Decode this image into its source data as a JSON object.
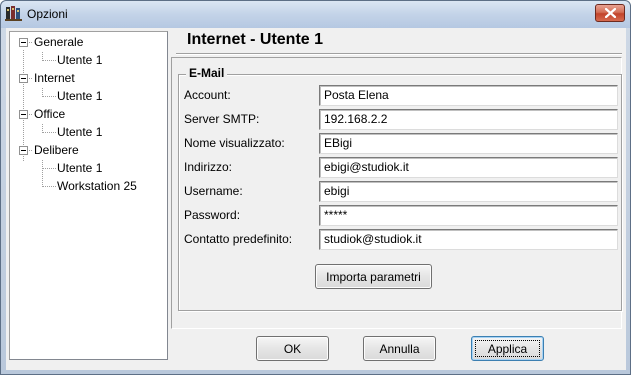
{
  "window": {
    "title": "Opzioni",
    "icon": "app-icon",
    "close_icon": "close-icon"
  },
  "tree": {
    "items": [
      {
        "label": "Generale",
        "level": 0
      },
      {
        "label": "Utente  1",
        "level": 1
      },
      {
        "label": "Internet",
        "level": 0
      },
      {
        "label": "Utente  1",
        "level": 1
      },
      {
        "label": "Office",
        "level": 0
      },
      {
        "label": "Utente  1",
        "level": 1
      },
      {
        "label": "Delibere",
        "level": 0
      },
      {
        "label": "Utente  1",
        "level": 1
      },
      {
        "label": "Workstation 25",
        "level": 1
      }
    ]
  },
  "panel": {
    "title": "Internet - Utente  1",
    "group_title": "E-Mail",
    "fields": [
      {
        "label": "Account:",
        "value": "Posta Elena"
      },
      {
        "label": "Server SMTP:",
        "value": "192.168.2.2"
      },
      {
        "label": "Nome visualizzato:",
        "value": "EBigi"
      },
      {
        "label": "Indirizzo:",
        "value": "ebigi@studiok.it"
      },
      {
        "label": "Username:",
        "value": "ebigi"
      },
      {
        "label": "Password:",
        "value": "*****"
      },
      {
        "label": "Contatto predefinito:",
        "value": "studiok@studiok.it"
      }
    ],
    "import_button": "Importa parametri"
  },
  "buttons": {
    "ok": "OK",
    "cancel": "Annulla",
    "apply": "Applica"
  }
}
